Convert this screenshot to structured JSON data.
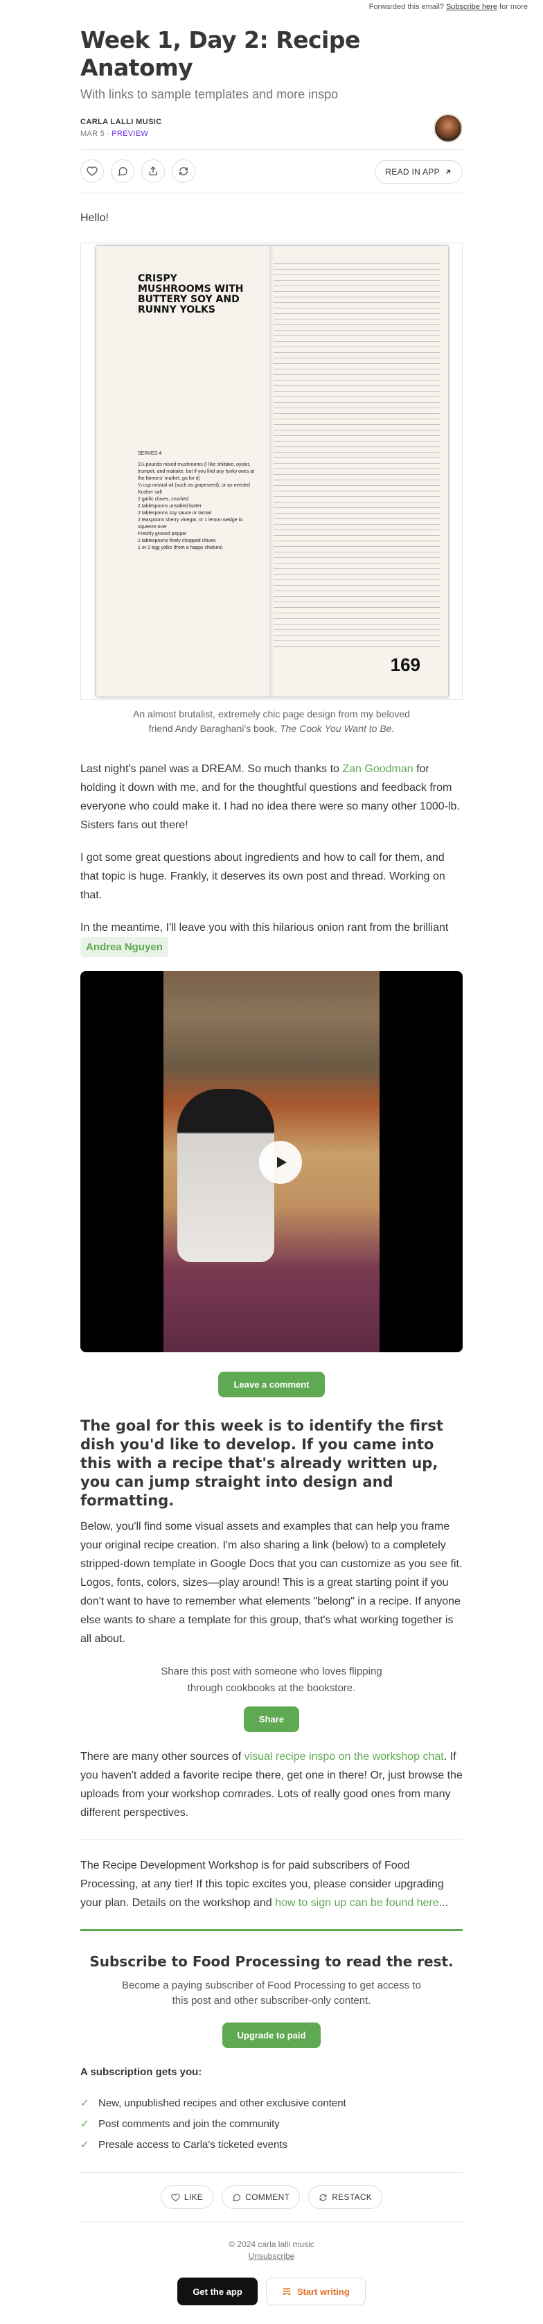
{
  "topbar": {
    "prefix": "Forwarded this email?",
    "link": "Subscribe here",
    "suffix": "for more"
  },
  "post": {
    "title": "Week 1, Day 2: Recipe Anatomy",
    "subtitle": "With links to sample templates and more inspo",
    "author": "CARLA LALLI MUSIC",
    "date": "MAR 5",
    "separator": "∙",
    "preview": "PREVIEW",
    "read_in_app": "READ IN APP"
  },
  "icons": {
    "like": "heart-icon",
    "comment": "comment-icon",
    "share": "share-icon",
    "restack": "restack-icon",
    "app": "arrow-up-right-icon",
    "play": "play-icon"
  },
  "figure": {
    "book_title": "CRISPY MUSHROOMS WITH BUTTERY SOY AND RUNNY YOLKS",
    "serves": "SERVES 4",
    "ingredients": [
      "1½ pounds mixed mushrooms (I like shiitake, oyster, trumpet, and maitake, but if you find any funky ones at the farmers' market, go for it)",
      "¼ cup neutral oil (such as grapeseed), or as needed",
      "Kosher salt",
      "2 garlic cloves, crushed",
      "2 tablespoons unsalted butter",
      "2 tablespoons soy sauce or tamari",
      "2 teaspoons sherry vinegar, or 1 lemon wedge to squeeze over",
      "Freshly ground pepper",
      "2 tablespoons finely chopped chives",
      "1 or 2 egg yolks (from a happy chicken)"
    ],
    "page_number": "169",
    "caption_prefix": "An almost brutalist, extremely chic page design from my beloved friend Andy Baraghani's book,",
    "caption_book": "The Cook You Want to Be."
  },
  "body": {
    "hello": "Hello!",
    "p1_a": "Last night's panel was a DREAM. So much thanks to ",
    "p1_link": "Zan Goodman",
    "p1_b": " for holding it down with me, and for the thoughtful questions and feedback from everyone who could make it. I had no idea there were so many other 1000-lb. Sisters fans out there!",
    "p2": "I got some great questions about ingredients and how to call for them, and that topic is huge. Frankly, it deserves its own post and thread. Working on that.",
    "p3": "In the meantime, I'll leave you with this hilarious onion rant from the brilliant",
    "mention": "Andrea Nguyen",
    "leave_comment": "Leave a comment",
    "h2": "The goal for this week is to identify the first dish you'd like to develop. If you came into this with a recipe that's already written up, you can jump straight into design and formatting.",
    "p4": "Below, you'll find some visual assets and examples that can help you frame your original recipe creation. I'm also sharing a link (below) to a completely stripped-down template in Google Docs that you can customize as you see fit. Logos, fonts, colors, sizes—play around! This is a great starting point if you don't want to have to remember what elements \"belong\" in a recipe. If anyone else wants to share a template for this group, that's what working together is all about.",
    "share_text": "Share this post with someone who loves flipping through cookbooks at the bookstore.",
    "share_btn": "Share",
    "p5_a": "There are many other sources of ",
    "p5_link": "visual recipe inspo on the workshop chat",
    "p5_b": ". If you haven't added a favorite recipe there, get one in there! Or, just browse the uploads from your workshop comrades. Lots of really good ones from many different perspectives.",
    "p6_a": "The Recipe Development Workshop is for paid subscribers of Food Processing, at any tier! If this topic excites you, please consider upgrading your plan. Details on the workshop and ",
    "p6_link": "how to sign up can be found here",
    "p6_b": "..."
  },
  "paywall": {
    "title": "Subscribe to Food Processing to read the rest.",
    "text": "Become a paying subscriber of Food Processing to get access to this post and other subscriber-only content.",
    "button": "Upgrade to paid",
    "gets_title": "A subscription gets you:",
    "benefits": [
      "New, unpublished recipes and other exclusive content",
      "Post comments and join the community",
      "Presale access to Carla's ticketed events"
    ]
  },
  "footer": {
    "like": "LIKE",
    "comment": "COMMENT",
    "restack": "RESTACK",
    "copyright": "© 2024 carla lalli music",
    "unsubscribe": "Unsubscribe",
    "get_app": "Get the app",
    "start_writing": "Start writing"
  },
  "colors": {
    "accent": "#5fa952",
    "text": "#363737",
    "preview": "#6b2fe0",
    "writing": "#e8702a"
  }
}
